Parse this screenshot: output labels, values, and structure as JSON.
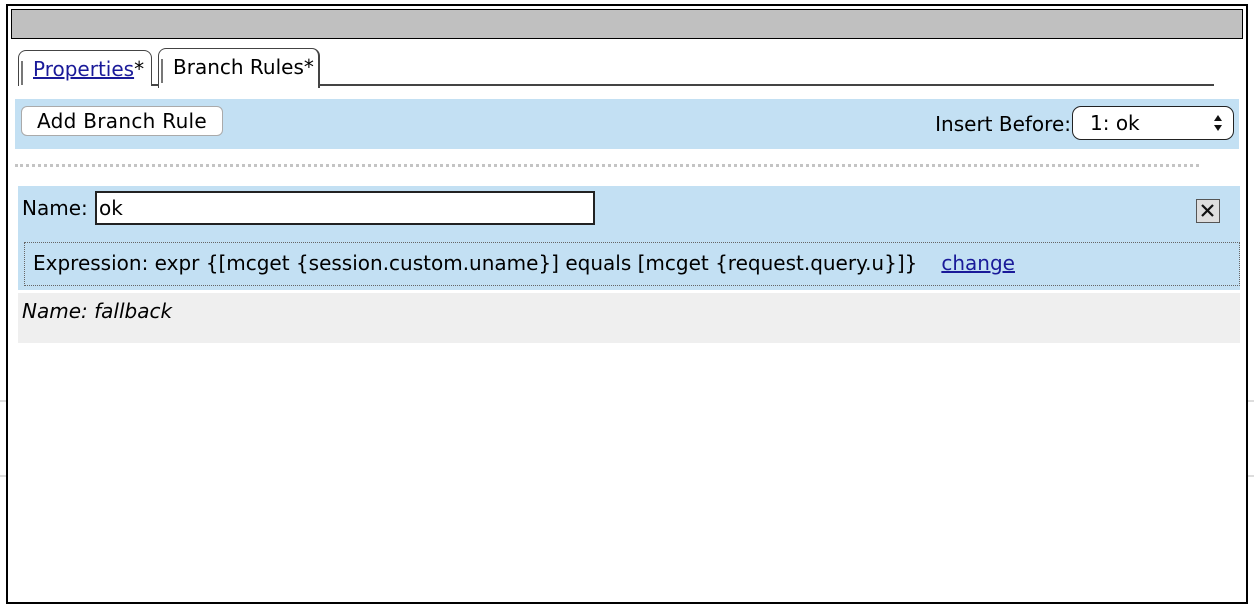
{
  "tabs": {
    "properties_label": "Properties",
    "properties_suffix": "*",
    "branch_rules_label": "Branch Rules*"
  },
  "toolbar": {
    "add_button_label": "Add Branch Rule",
    "insert_before_label": "Insert Before:",
    "insert_before_value": "1: ok"
  },
  "rule": {
    "name_label": "Name:",
    "name_value": "ok",
    "expression_text": "Expression: expr {[mcget {session.custom.uname}] equals [mcget {request.query.u}]}",
    "change_link": "change"
  },
  "fallback": {
    "label": "Name: fallback"
  }
}
